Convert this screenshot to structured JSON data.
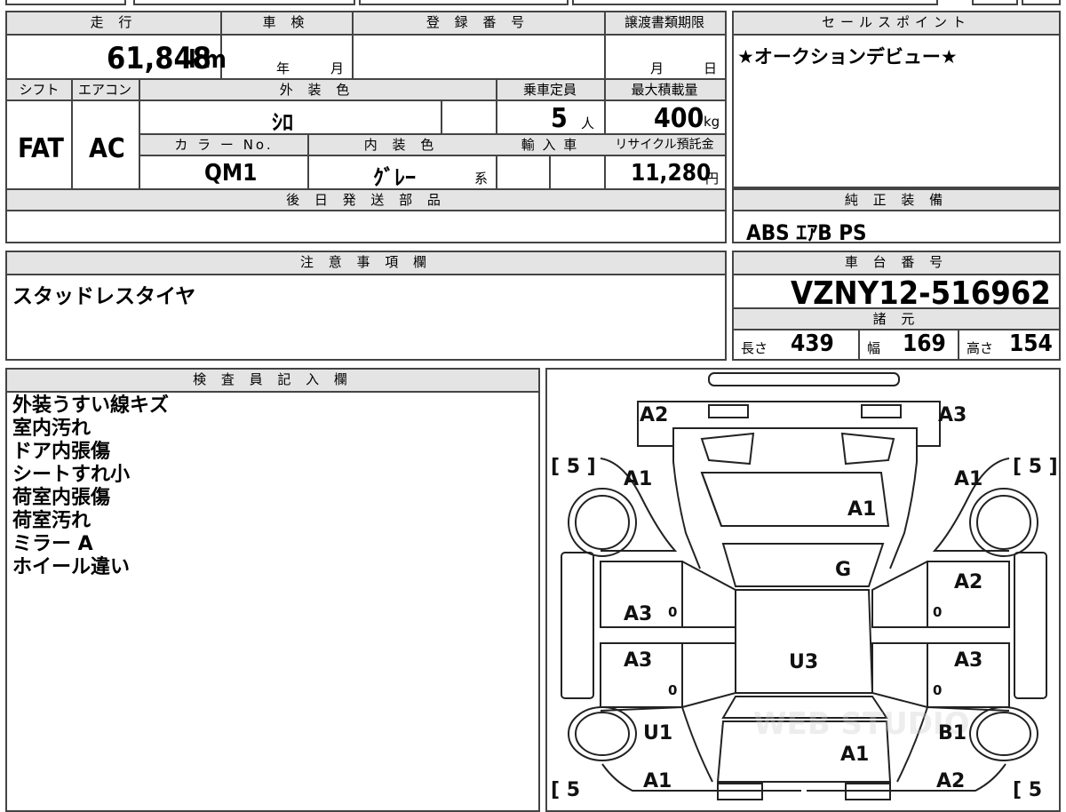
{
  "headers": {
    "mileage": "走 行",
    "inspection": "車 検",
    "registration": "登 録 番 号",
    "transfer_deadline": "譲渡書類期限",
    "sales_point": "セールスポイント",
    "shift": "シフト",
    "aircon": "エアコン",
    "exterior_color": "外 装 色",
    "capacity": "乗車定員",
    "max_load": "最大積載量",
    "color_no": "カ ラ ー No.",
    "interior_color": "内 装 色",
    "import": "輸 入 車",
    "recycle": "リサイクル預託金",
    "parts_later": "後 日 発 送 部 品",
    "genuine_equipment": "純 正 装 備",
    "notes": "注 意 事 項 欄",
    "chassis_no": "車 台 番 号",
    "specs": "諸 元",
    "inspector": "検 査 員 記 入 欄"
  },
  "values": {
    "mileage": "61,848",
    "mileage_unit": "km",
    "year_unit": "年",
    "month_unit": "月",
    "deadline_month": "月",
    "deadline_day": "日",
    "sales_point_text": "★オークションデビュー★",
    "shift": "FAT",
    "aircon": "AC",
    "exterior_color": "ｼﾛ",
    "capacity": "5",
    "capacity_unit": "人",
    "max_load": "400",
    "max_load_unit": "kg",
    "color_no": "QM1",
    "interior_color": "ｸﾞﾚｰ",
    "interior_suffix": "系",
    "recycle": "11,280",
    "recycle_unit": "円",
    "genuine_equipment": "ABS ｴｱB PS",
    "notes_text": "スタッドレスタイヤ",
    "chassis_no": "VZNY12-516962",
    "length_label": "長さ",
    "length": "439",
    "width_label": "幅",
    "width": "169",
    "height_label": "高さ",
    "height": "154"
  },
  "inspector_notes": [
    "外装うすい線キズ",
    "室内汚れ",
    "ドア内張傷",
    "シートすれ小",
    "荷室内張傷",
    "荷室汚れ",
    "ミラー A",
    "ホイール違い"
  ],
  "diagram": {
    "tire_left_top": "[ 5 ]",
    "tire_right_top": "[ 5 ]",
    "tire_left_bottom": "[ 5",
    "tire_right_bottom": "[ 5",
    "rear_left": "A2",
    "rear_right": "A3",
    "rear_quarter_left": "A1",
    "rear_quarter_right": "A1",
    "rear_glass": "A1",
    "roof": "G",
    "left_rear_door": "A3",
    "left_rear_door_sub": "0",
    "left_front_door": "A3",
    "left_front_door_sub": "0",
    "right_rear_door": "A2",
    "right_rear_door_sub": "0",
    "right_front_door": "A3",
    "right_front_door_sub": "0",
    "floor": "U3",
    "left_front_fender": "U1",
    "right_front_fender": "B1",
    "hood": "A1",
    "front_left": "A1",
    "front_right": "A2",
    "watermark": "WEB STUDIO"
  }
}
